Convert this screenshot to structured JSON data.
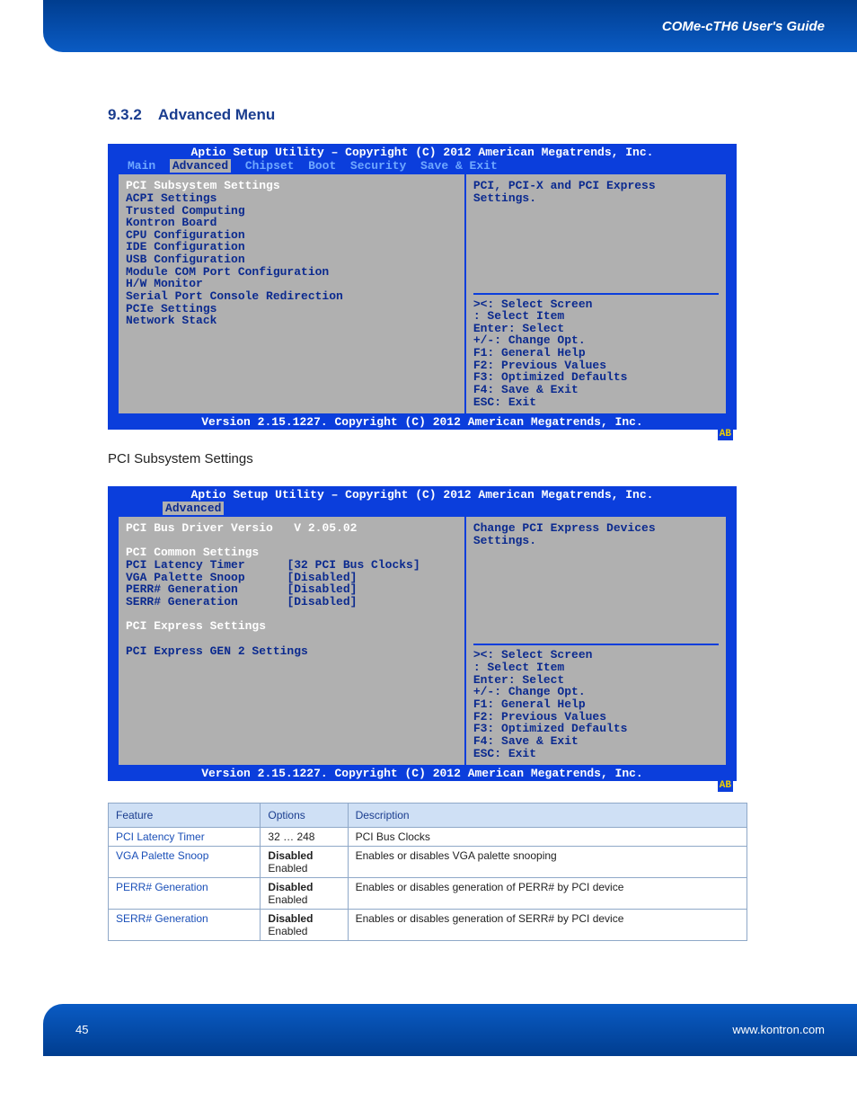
{
  "header": {
    "guide_title": "COMe-cTH6 User's Guide"
  },
  "section": {
    "number": "9.3.2",
    "title": "Advanced Menu"
  },
  "bios1": {
    "title": "Aptio Setup Utility – Copyright (C) 2012 American Megatrends, Inc.",
    "tabs": [
      "Main",
      "Advanced",
      "Chipset",
      "Boot",
      "Security",
      "Save & Exit"
    ],
    "selected_tab": "Advanced",
    "menu_items": [
      "PCI Subsystem Settings",
      "ACPI Settings",
      "Trusted Computing",
      "Kontron Board",
      "CPU Configuration",
      "IDE Configuration",
      "USB Configuration",
      "Module COM Port Configuration",
      "H/W Monitor",
      "Serial Port Console Redirection",
      "PCIe Settings",
      "Network Stack"
    ],
    "help_top": "PCI, PCI-X and PCI Express Settings.",
    "help_bottom": [
      "><: Select Screen",
      "  : Select Item",
      "Enter: Select",
      "+/-: Change Opt.",
      "F1: General Help",
      "F2: Previous Values",
      "F3: Optimized Defaults",
      "F4: Save & Exit",
      "ESC: Exit"
    ],
    "footer": "Version 2.15.1227. Copyright (C) 2012 American Megatrends, Inc.",
    "badge": "AB"
  },
  "subheading": "PCI Subsystem Settings",
  "bios2": {
    "title": "Aptio Setup Utility – Copyright (C) 2012 American Megatrends, Inc.",
    "selected_tab": "Advanced",
    "rows": [
      {
        "label": "PCI Bus Driver Versio",
        "value": "V 2.05.02",
        "hl": true
      },
      {
        "label": "",
        "value": ""
      },
      {
        "label": "PCI Common Settings",
        "value": "",
        "hl": true
      },
      {
        "label": "PCI Latency Timer",
        "value": "[32 PCI Bus Clocks]"
      },
      {
        "label": "VGA Palette Snoop",
        "value": "[Disabled]"
      },
      {
        "label": "PERR# Generation",
        "value": "[Disabled]"
      },
      {
        "label": "SERR# Generation",
        "value": "[Disabled]"
      },
      {
        "label": "",
        "value": ""
      },
      {
        "label": "PCI Express Settings",
        "value": "",
        "hl": true
      },
      {
        "label": "",
        "value": ""
      },
      {
        "label": "PCI Express GEN 2 Settings",
        "value": ""
      }
    ],
    "help_top": "Change PCI Express Devices Settings.",
    "help_bottom": [
      "><: Select Screen",
      "  : Select Item",
      "Enter: Select",
      "+/-: Change Opt.",
      "F1: General Help",
      "F2: Previous Values",
      "F3: Optimized Defaults",
      "F4: Save & Exit",
      "ESC: Exit"
    ],
    "footer": "Version 2.15.1227. Copyright (C) 2012 American Megatrends, Inc.",
    "badge": "AB"
  },
  "table": {
    "headers": [
      "Feature",
      "Options",
      "Description"
    ],
    "rows": [
      {
        "feature": "PCI Latency Timer",
        "options": "32 … 248",
        "desc": "PCI Bus Clocks"
      },
      {
        "feature": "VGA Palette Snoop",
        "options_bold": "Disabled",
        "options_rest": "Enabled",
        "desc": "Enables or disables VGA palette snooping"
      },
      {
        "feature": "PERR# Generation",
        "options_bold": "Disabled",
        "options_rest": "Enabled",
        "desc": "Enables or disables generation of PERR# by PCI device"
      },
      {
        "feature": "SERR# Generation",
        "options_bold": "Disabled",
        "options_rest": "Enabled",
        "desc": "Enables or disables generation of SERR# by PCI device"
      }
    ]
  },
  "footer": {
    "page": "45",
    "url": "www.kontron.com"
  }
}
